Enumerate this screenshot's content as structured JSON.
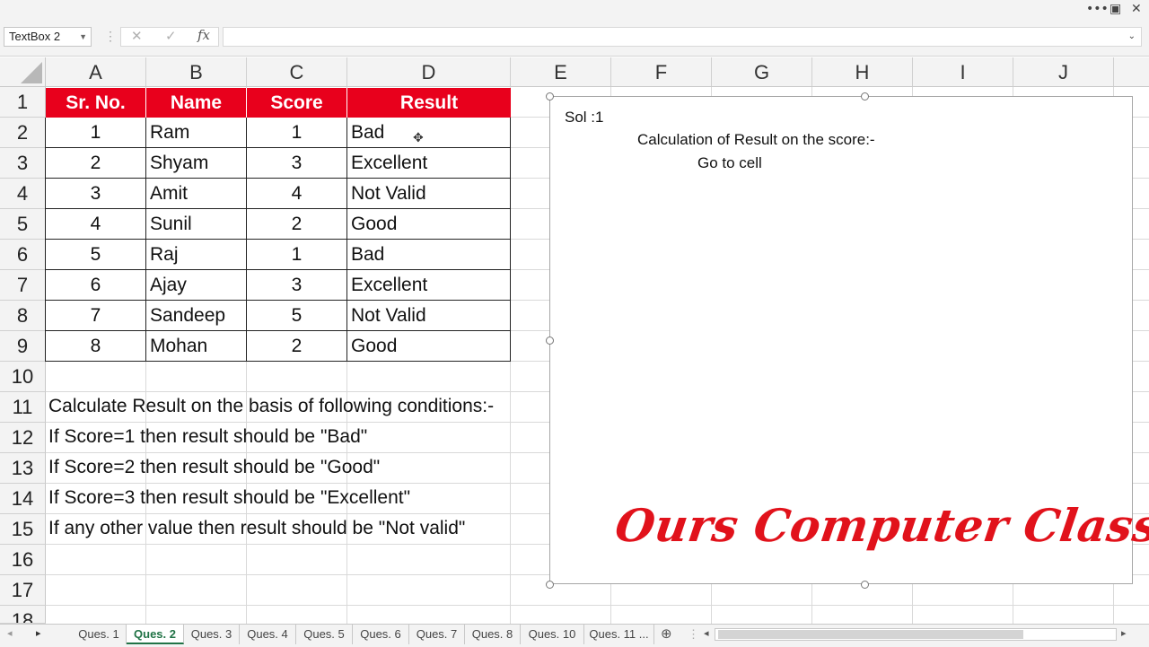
{
  "window": {
    "more_label": "•••",
    "restore_label": "▣",
    "close_label": "✕"
  },
  "formula_bar": {
    "name_box": "TextBox 2",
    "cancel_icon": "✕",
    "enter_icon": "✓",
    "fx_label": "fx",
    "value": ""
  },
  "columns": [
    "A",
    "B",
    "C",
    "D",
    "E",
    "F",
    "G",
    "H",
    "I",
    "J"
  ],
  "rows": [
    "1",
    "2",
    "3",
    "4",
    "5",
    "6",
    "7",
    "8",
    "9",
    "10",
    "11",
    "12",
    "13",
    "14",
    "15",
    "16",
    "17",
    "18"
  ],
  "table": {
    "headers": [
      "Sr. No.",
      "Name",
      "Score",
      "Result"
    ],
    "rows": [
      [
        "1",
        "Ram",
        "1",
        "Bad"
      ],
      [
        "2",
        "Shyam",
        "3",
        "Excellent"
      ],
      [
        "3",
        "Amit",
        "4",
        "Not Valid"
      ],
      [
        "4",
        "Sunil",
        "2",
        "Good"
      ],
      [
        "5",
        "Raj",
        "1",
        "Bad"
      ],
      [
        "6",
        "Ajay",
        "3",
        "Excellent"
      ],
      [
        "7",
        "Sandeep",
        "5",
        "Not Valid"
      ],
      [
        "8",
        "Mohan",
        "2",
        "Good"
      ]
    ],
    "header_color": "#e8001c"
  },
  "notes": [
    "Calculate Result on the basis of following conditions:-",
    "If Score=1 then result should be \"Bad\"",
    "If Score=2 then result should be \"Good\"",
    "If Score=3 then result should be \"Excellent\"",
    "If any other value then result should be \"Not valid\""
  ],
  "textbox": {
    "sol": "Sol :1",
    "line1": "Calculation of Result on the score:-",
    "line2": "Go to cell",
    "brand": "Ours Computer Classes",
    "brand_color": "#e1121b"
  },
  "sheet_tabs": [
    "Ques. 1",
    "Ques. 2",
    "Ques. 3",
    "Ques. 4",
    "Ques. 5",
    "Ques. 6",
    "Ques. 7",
    "Ques. 8",
    "Ques. 10",
    "Ques. 11 ..."
  ],
  "active_tab": "Ques. 2",
  "nav": {
    "next": "▸",
    "add": "⊕",
    "scroll_left": "◂",
    "scroll_right": "▸"
  }
}
